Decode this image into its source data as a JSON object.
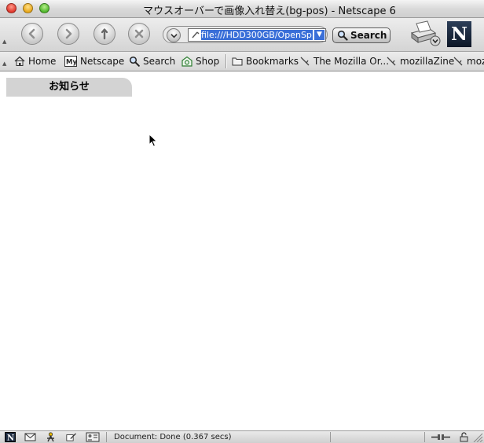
{
  "window": {
    "title": "マウスオーバーで画像入れ替え(bg-pos) - Netscape 6"
  },
  "navigation": {
    "back": "back-arrow",
    "forward": "forward-arrow",
    "reload": "reload",
    "stop": "stop",
    "url": "file:///HDD300GB/OpenSp",
    "search_label": "Search"
  },
  "personal_toolbar": {
    "items": [
      {
        "label": "Home",
        "icon": "home-icon"
      },
      {
        "label": "Netscape",
        "icon": "my-netscape-icon"
      },
      {
        "label": "Search",
        "icon": "search-icon"
      },
      {
        "label": "Shop",
        "icon": "shop-icon"
      },
      {
        "label": "Bookmarks",
        "icon": "folder-icon"
      },
      {
        "label": "The Mozilla Or...",
        "icon": "bookmark-icon"
      },
      {
        "label": "mozillaZine",
        "icon": "bookmark-icon"
      },
      {
        "label": "moz",
        "icon": "bookmark-icon"
      }
    ]
  },
  "page": {
    "tab_label": "お知らせ"
  },
  "status": {
    "text": "Document: Done (0.367 secs)"
  },
  "colors": {
    "tab_background": "#d3d3d3",
    "url_selection": "#3a6fd8",
    "netscape_logo": "#1a2a40"
  }
}
